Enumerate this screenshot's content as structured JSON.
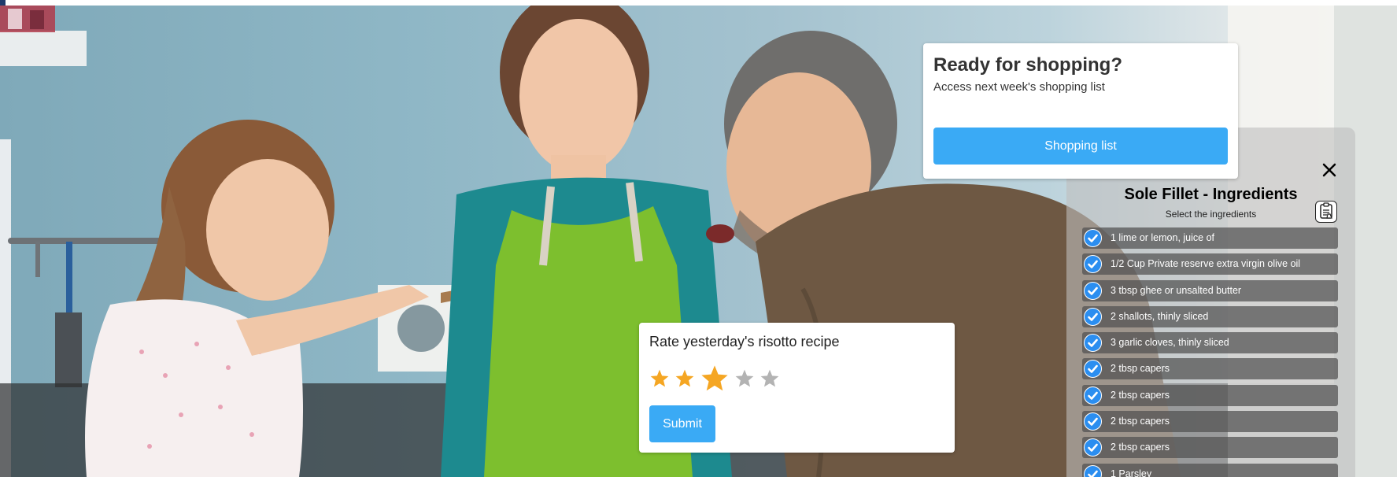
{
  "colors": {
    "accent": "#3aaaf5",
    "check": "#2b8ef0",
    "star_filled": "#f5a623",
    "star_empty": "#b3b3b3"
  },
  "hero": {
    "image": "family-cooking-photo"
  },
  "shopping": {
    "title": "Ready for shopping?",
    "subtitle": "Access next week's shopping list",
    "button_label": "Shopping list"
  },
  "ingredients": {
    "title": "Sole Fillet - Ingredients",
    "subtitle": "Select the ingredients",
    "close_icon": "close-icon",
    "list_icon": "shopping-list-icon",
    "items": [
      {
        "label": "1 lime or lemon, juice of",
        "checked": true
      },
      {
        "label": "1/2 Cup Private reserve extra virgin olive oil",
        "checked": true
      },
      {
        "label": "3 tbsp ghee or unsalted butter",
        "checked": true
      },
      {
        "label": "2 shallots, thinly sliced",
        "checked": true
      },
      {
        "label": "3 garlic cloves, thinly sliced",
        "checked": true
      },
      {
        "label": "2 tbsp capers",
        "checked": true
      },
      {
        "label": "2 tbsp capers",
        "checked": true
      },
      {
        "label": "2 tbsp capers",
        "checked": true
      },
      {
        "label": "2 tbsp capers",
        "checked": true
      },
      {
        "label": "1 Parsley",
        "checked": true
      }
    ]
  },
  "rating": {
    "title": "Rate yesterday's risotto recipe",
    "value": 3,
    "max": 5,
    "hovered_star": 3,
    "submit_label": "Submit"
  }
}
